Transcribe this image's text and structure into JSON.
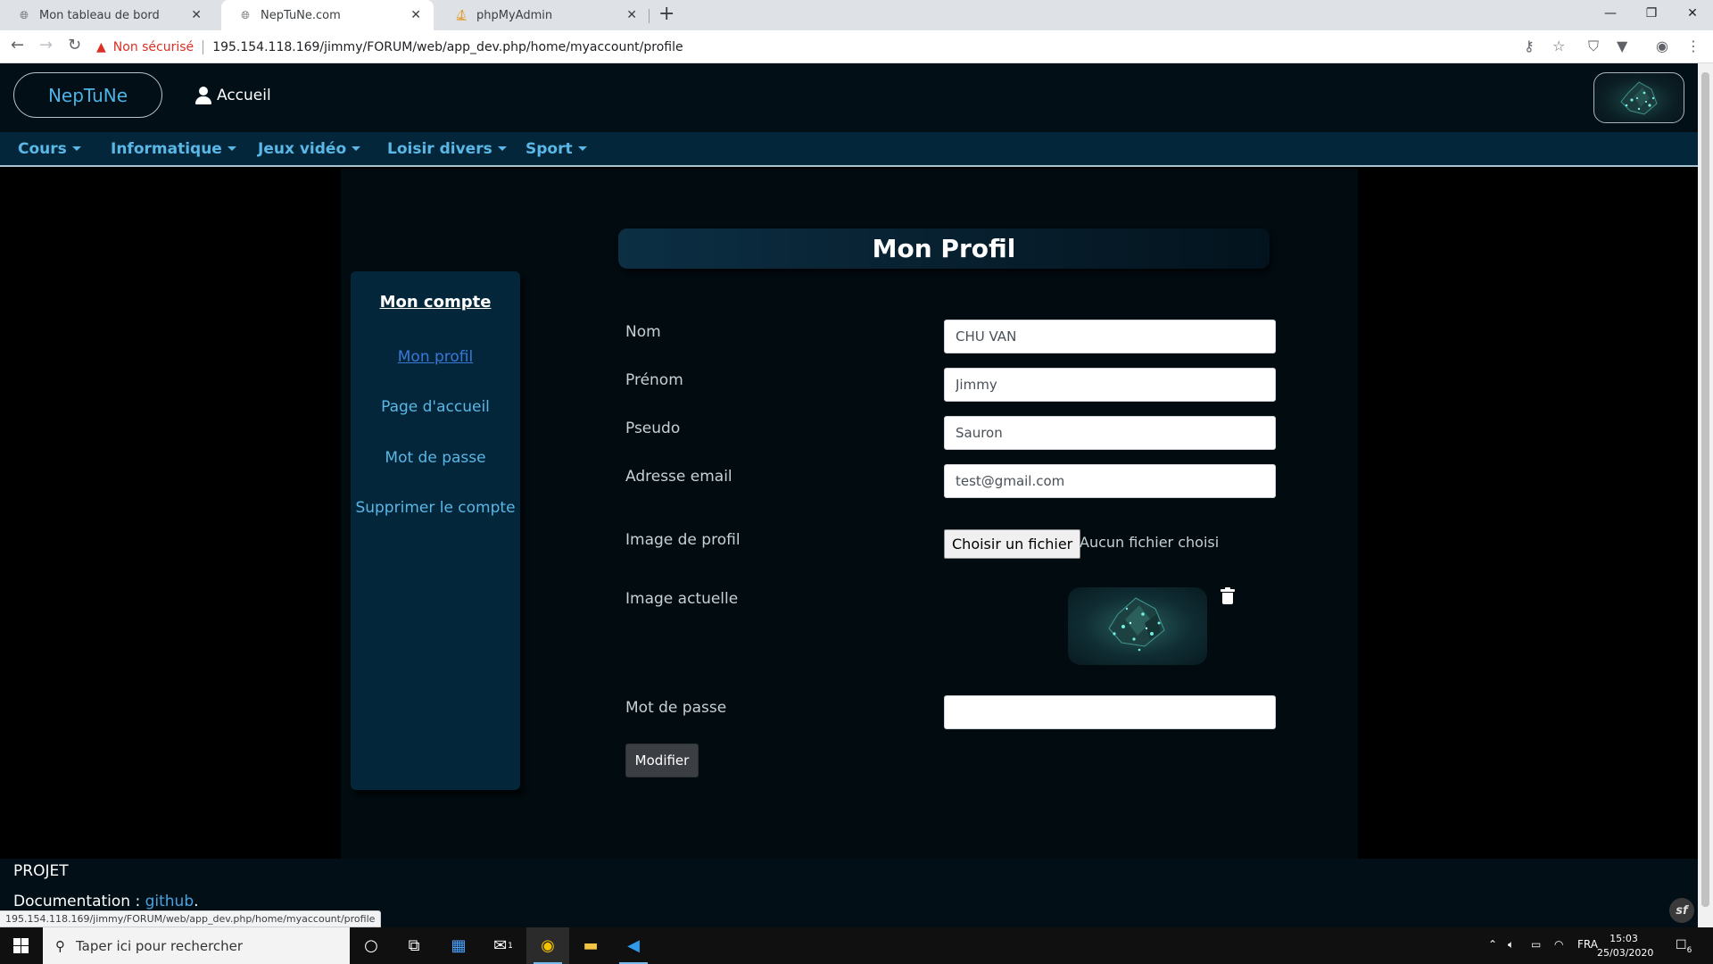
{
  "browser": {
    "tabs": [
      {
        "title": "Mon tableau de bord",
        "icon": "globe-icon"
      },
      {
        "title": "NepTuNe.com",
        "icon": "globe-icon"
      },
      {
        "title": "phpMyAdmin",
        "icon": "phpmyadmin-icon"
      }
    ],
    "security_label": "Non sécurisé",
    "url": "195.154.118.169/jimmy/FORUM/web/app_dev.php/home/myaccount/profile",
    "status_url": "195.154.118.169/jimmy/FORUM/web/app_dev.php/home/myaccount/profile"
  },
  "site": {
    "brand": "NepTuNe",
    "home_label": "Accueil",
    "categories": [
      "Cours",
      "Informatique",
      "Jeux vidéo",
      "Loisir divers",
      "Sport"
    ]
  },
  "sidebar": {
    "title": "Mon compte",
    "links": [
      {
        "label": "Mon profil",
        "active": true
      },
      {
        "label": "Page d'accueil",
        "active": false
      },
      {
        "label": "Mot de passe",
        "active": false
      },
      {
        "label": "Supprimer le compte",
        "active": false
      }
    ]
  },
  "profile": {
    "heading": "Mon Profil",
    "fields": {
      "nom": {
        "label": "Nom",
        "value": "CHU VAN"
      },
      "prenom": {
        "label": "Prénom",
        "value": "Jimmy"
      },
      "pseudo": {
        "label": "Pseudo",
        "value": "Sauron"
      },
      "email": {
        "label": "Adresse email",
        "value": "test@gmail.com"
      },
      "image": {
        "label": "Image de profil",
        "button": "Choisir un fichier",
        "status": "Aucun fichier choisi"
      },
      "current_image": {
        "label": "Image actuelle"
      },
      "password": {
        "label": "Mot de passe",
        "value": ""
      }
    },
    "submit_label": "Modifier"
  },
  "footer": {
    "title": "PROJET",
    "doc_prefix": "Documentation : ",
    "doc_link": "github",
    "doc_suffix": "."
  },
  "taskbar": {
    "search_placeholder": "Taper ici pour rechercher",
    "language": "FRA",
    "time": "15:03",
    "date": "25/03/2020",
    "notification_count": "6",
    "mail_badge": "1"
  },
  "colors": {
    "accent": "#5ab7e6",
    "header_bg": "#020f17",
    "catbar_bg": "#03263a",
    "warning": "#d93025"
  }
}
